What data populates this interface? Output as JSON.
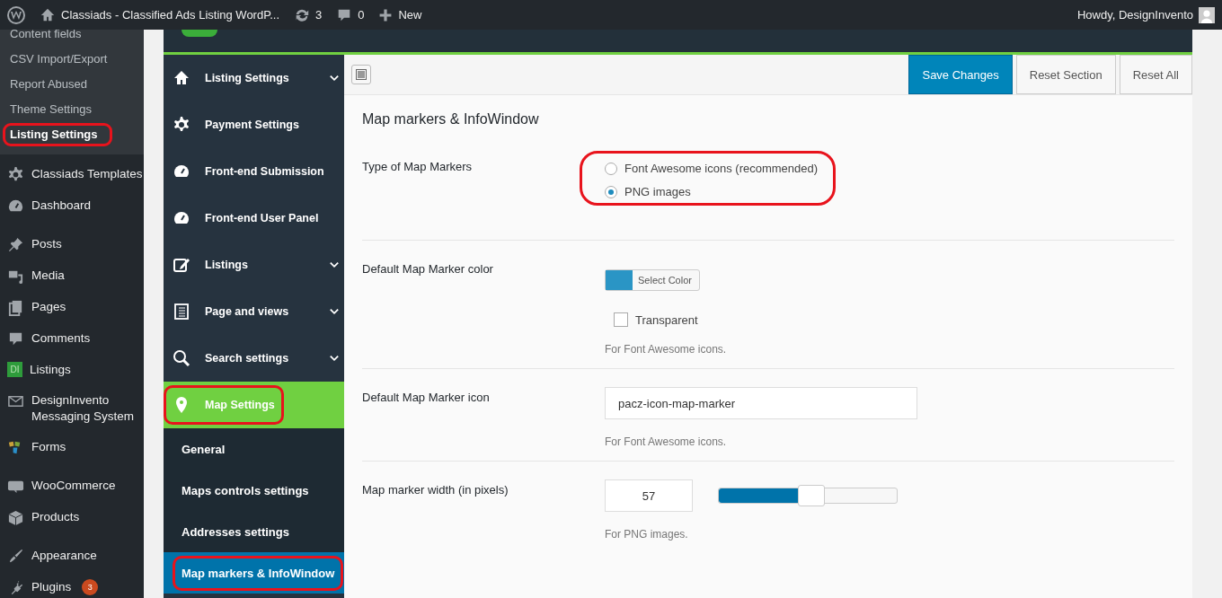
{
  "admin_bar": {
    "site_title": "Classiads - Classified Ads Listing WordP...",
    "updates": "3",
    "comments": "0",
    "new_label": "New",
    "greeting": "Howdy, DesignInvento"
  },
  "admin_menu": {
    "submenu": [
      {
        "label": "Content fields",
        "current": false,
        "circled": false
      },
      {
        "label": "CSV Import/Export",
        "current": false,
        "circled": false
      },
      {
        "label": "Report Abused",
        "current": false,
        "circled": false
      },
      {
        "label": "Theme Settings",
        "current": false,
        "circled": false
      },
      {
        "label": "Listing Settings",
        "current": true,
        "circled": true
      }
    ],
    "groups": [
      [
        {
          "label": "Classiads Templates"
        },
        {
          "label": "Dashboard"
        }
      ],
      [
        {
          "label": "Posts"
        },
        {
          "label": "Media"
        },
        {
          "label": "Pages"
        },
        {
          "label": "Comments"
        },
        {
          "label": "Listings",
          "icon_text": "DI"
        },
        {
          "label": "DesignInvento Messaging System"
        },
        {
          "label": "Forms"
        }
      ],
      [
        {
          "label": "WooCommerce"
        },
        {
          "label": "Products"
        }
      ],
      [
        {
          "label": "Appearance"
        },
        {
          "label": "Plugins",
          "badge": "3"
        }
      ]
    ]
  },
  "options_nav": [
    {
      "label": "Listing Settings",
      "expandable": true,
      "selected": false,
      "circled": false
    },
    {
      "label": "Payment Settings",
      "expandable": false,
      "selected": false,
      "circled": false
    },
    {
      "label": "Front-end Submission",
      "expandable": false,
      "selected": false,
      "circled": false
    },
    {
      "label": "Front-end User Panel",
      "expandable": false,
      "selected": false,
      "circled": false
    },
    {
      "label": "Listings",
      "expandable": true,
      "selected": false,
      "circled": false
    },
    {
      "label": "Page and views",
      "expandable": true,
      "selected": false,
      "circled": false
    },
    {
      "label": "Search settings",
      "expandable": true,
      "selected": false,
      "circled": false
    },
    {
      "label": "Map Settings",
      "expandable": false,
      "selected": true,
      "circled": true,
      "children": [
        {
          "label": "General",
          "selected": false,
          "circled": false
        },
        {
          "label": "Maps controls settings",
          "selected": false,
          "circled": false
        },
        {
          "label": "Addresses settings",
          "selected": false,
          "circled": false
        },
        {
          "label": "Map markers & InfoWindow",
          "selected": true,
          "circled": true
        }
      ]
    }
  ],
  "toolbar": {
    "buttons": [
      {
        "label": "Save Changes",
        "primary": true
      },
      {
        "label": "Reset Section",
        "primary": false
      },
      {
        "label": "Reset All",
        "primary": false
      }
    ]
  },
  "section_title": "Map markers & InfoWindow",
  "fields": [
    {
      "kind": "radio",
      "label": "Type of Map Markers",
      "circled": true,
      "options": [
        {
          "label": "Font Awesome icons (recommended)",
          "selected": false
        },
        {
          "label": "PNG images",
          "selected": true
        }
      ]
    },
    {
      "kind": "color",
      "label": "Default Map Marker color",
      "color": "#2a95c5",
      "button": "Select Color",
      "checkbox": {
        "label": "Transparent",
        "checked": false
      },
      "help": "For Font Awesome icons."
    },
    {
      "kind": "text",
      "label": "Default Map Marker icon",
      "value": "pacz-icon-map-marker",
      "help": "For Font Awesome icons."
    },
    {
      "kind": "slider",
      "label": "Map marker width (in pixels)",
      "value": "57",
      "level": 0.52,
      "help": "For PNG images."
    }
  ]
}
